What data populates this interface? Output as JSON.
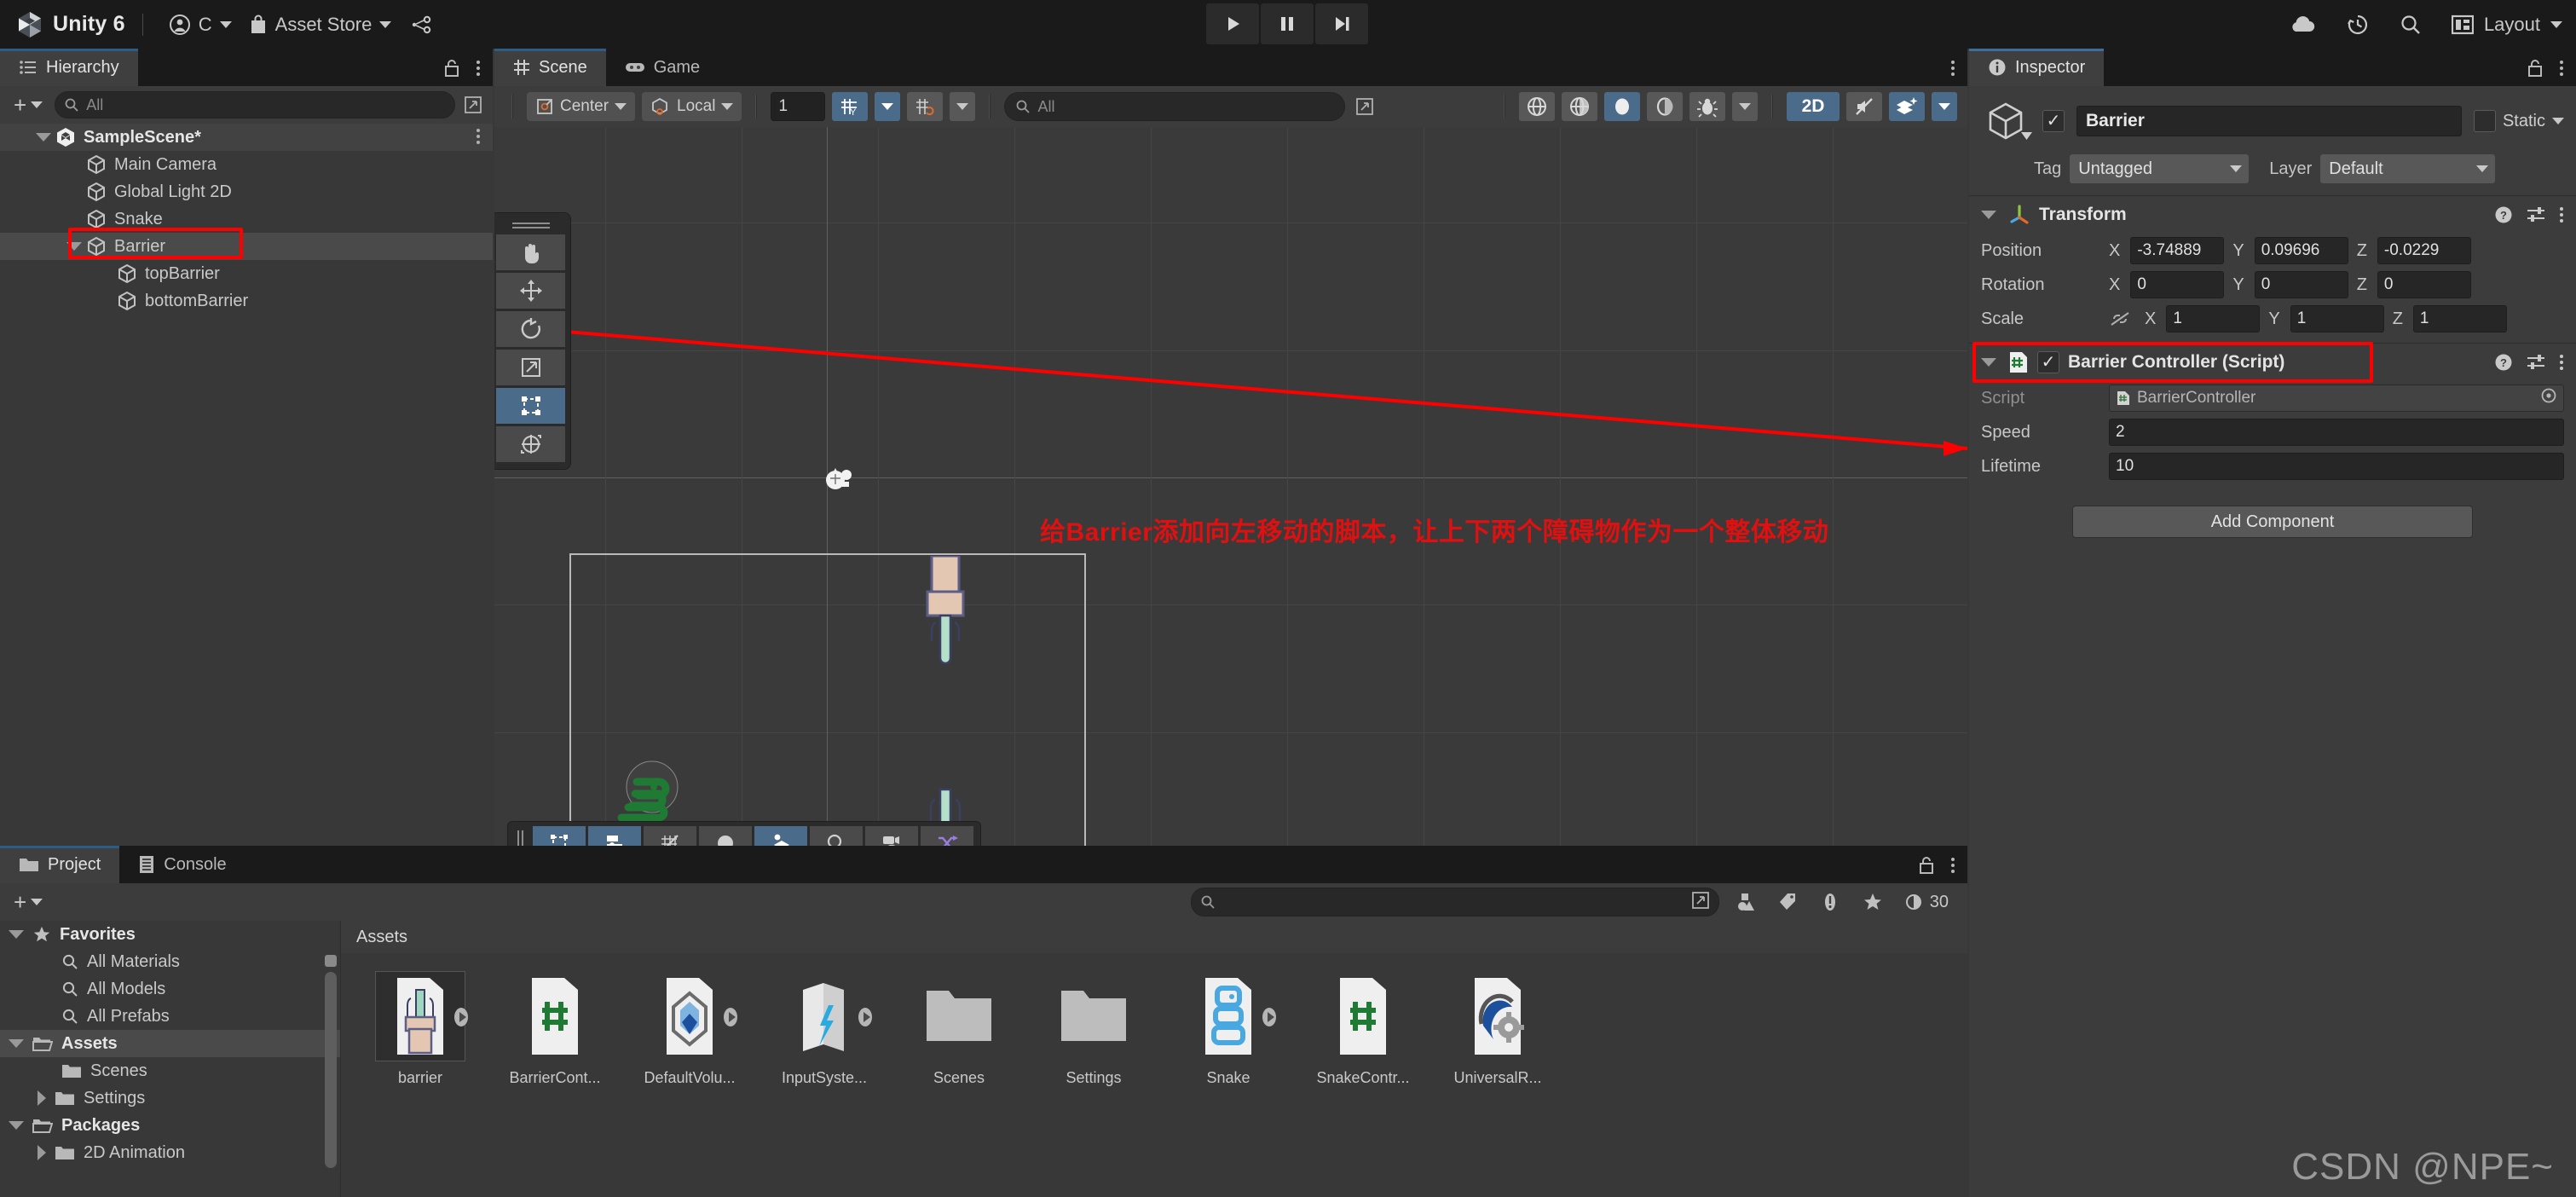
{
  "topbar": {
    "app_title": "Unity 6",
    "account_label": "C",
    "asset_store_label": "Asset Store",
    "icons": [
      "unity-logo-icon",
      "account-icon",
      "asset-store-bag-icon",
      "version-control-icon",
      "cloud-icon",
      "history-icon",
      "search-icon",
      "layout-icon"
    ],
    "layout_label": "Layout",
    "play_controls": [
      "play-button",
      "pause-button",
      "step-button"
    ]
  },
  "hierarchy": {
    "tab_label": "Hierarchy",
    "search_placeholder": "All",
    "items": [
      {
        "label": "SampleScene*",
        "depth": 0,
        "kind": "scene",
        "expanded": true,
        "selected": false
      },
      {
        "label": "Main Camera",
        "depth": 1,
        "kind": "gameobject",
        "expanded": false,
        "selected": false
      },
      {
        "label": "Global Light 2D",
        "depth": 1,
        "kind": "gameobject",
        "expanded": false,
        "selected": false
      },
      {
        "label": "Snake",
        "depth": 1,
        "kind": "gameobject",
        "expanded": false,
        "selected": false
      },
      {
        "label": "Barrier",
        "depth": 1,
        "kind": "gameobject",
        "expanded": true,
        "selected": true
      },
      {
        "label": "topBarrier",
        "depth": 2,
        "kind": "gameobject",
        "expanded": false,
        "selected": false
      },
      {
        "label": "bottomBarrier",
        "depth": 2,
        "kind": "gameobject",
        "expanded": false,
        "selected": false
      }
    ]
  },
  "scene": {
    "tabs": [
      {
        "label": "Scene",
        "icon": "grid-icon",
        "active": true
      },
      {
        "label": "Game",
        "icon": "gamepad-icon",
        "active": false
      }
    ],
    "toolbar": {
      "pivot_label": "Center",
      "handle_label": "Local",
      "grid_snap_value": "1",
      "search_placeholder": "All",
      "toggle_2d_label": "2D",
      "toggles": [
        "grid-snap-icon",
        "increment-snap-icon",
        "lighting-icon",
        "audio-icon",
        "fx-filled-icon",
        "fx-outline-icon",
        "debug-bug-icon",
        "2d-toggle",
        "audio-mute-icon",
        "effects-icon"
      ]
    },
    "tools_overlay": [
      "hand-tool",
      "move-tool",
      "rotate-tool",
      "scale-tool",
      "rect-tool",
      "transform-tool"
    ],
    "tools_active_index": 4,
    "bottom_overlay": [
      "rect-select-icon",
      "sliders-icon",
      "grid-visibility-icon",
      "sphere-icon",
      "layers-icon",
      "zoom-icon",
      "camera-preview-icon",
      "shuffle-icon"
    ],
    "annotation": "给Barrier添加向左移动的脚本，让上下两个障碍物作为一个整体移动"
  },
  "inspector": {
    "tab_label": "Inspector",
    "object_name": "Barrier",
    "object_enabled": true,
    "static_label": "Static",
    "static_checked": false,
    "tag_label": "Tag",
    "tag_value": "Untagged",
    "layer_label": "Layer",
    "layer_value": "Default",
    "transform": {
      "title": "Transform",
      "rows": [
        {
          "label": "Position",
          "x": "-3.74889",
          "y": "0.09696",
          "z": "-0.0229"
        },
        {
          "label": "Rotation",
          "x": "0",
          "y": "0",
          "z": "0"
        },
        {
          "label": "Scale",
          "x": "1",
          "y": "1",
          "z": "1"
        }
      ],
      "axis_labels": [
        "X",
        "Y",
        "Z"
      ]
    },
    "component": {
      "title": "Barrier Controller (Script)",
      "enabled": true,
      "script_label": "Script",
      "script_value": "BarrierController",
      "fields": [
        {
          "label": "Speed",
          "value": "2"
        },
        {
          "label": "Lifetime",
          "value": "10"
        }
      ]
    },
    "add_component_label": "Add Component"
  },
  "project": {
    "tabs": [
      {
        "label": "Project",
        "icon": "folder-icon",
        "active": true
      },
      {
        "label": "Console",
        "icon": "console-icon",
        "active": false
      }
    ],
    "search_placeholder": "",
    "visible_count": "30",
    "assets_breadcrumb": "Assets",
    "tree": [
      {
        "label": "Favorites",
        "depth": 0,
        "icon": "star-icon",
        "bold": true,
        "expanded": true,
        "selected": false
      },
      {
        "label": "All Materials",
        "depth": 1,
        "icon": "search-icon",
        "bold": false,
        "expanded": null,
        "selected": false
      },
      {
        "label": "All Models",
        "depth": 1,
        "icon": "search-icon",
        "bold": false,
        "expanded": null,
        "selected": false
      },
      {
        "label": "All Prefabs",
        "depth": 1,
        "icon": "search-icon",
        "bold": false,
        "expanded": null,
        "selected": false
      },
      {
        "label": "Assets",
        "depth": 0,
        "icon": "folder-open-icon",
        "bold": true,
        "expanded": true,
        "selected": true
      },
      {
        "label": "Scenes",
        "depth": 1,
        "icon": "folder-icon",
        "bold": false,
        "expanded": null,
        "selected": false
      },
      {
        "label": "Settings",
        "depth": 1,
        "icon": "folder-icon",
        "bold": false,
        "expanded": false,
        "selected": false
      },
      {
        "label": "Packages",
        "depth": 0,
        "icon": "folder-open-icon",
        "bold": true,
        "expanded": true,
        "selected": false
      },
      {
        "label": "2D Animation",
        "depth": 1,
        "icon": "folder-icon",
        "bold": false,
        "expanded": false,
        "selected": false
      }
    ],
    "assets": [
      {
        "label": "barrier",
        "type": "prefab",
        "selected": true
      },
      {
        "label": "BarrierCont...",
        "type": "script",
        "selected": false
      },
      {
        "label": "DefaultVolu...",
        "type": "volume-profile",
        "selected": false
      },
      {
        "label": "InputSyste...",
        "type": "input-actions",
        "selected": false
      },
      {
        "label": "Scenes",
        "type": "folder",
        "selected": false
      },
      {
        "label": "Settings",
        "type": "folder",
        "selected": false
      },
      {
        "label": "Snake",
        "type": "prefab-snake",
        "selected": false
      },
      {
        "label": "SnakeContr...",
        "type": "script",
        "selected": false
      },
      {
        "label": "UniversalR...",
        "type": "render-pipeline",
        "selected": false
      }
    ]
  },
  "watermark": "CSDN @NPE~",
  "colors": {
    "accent_blue": "#4b6b8a",
    "annotation_red": "#e01010",
    "panel_bg": "#383838",
    "toolbar_bg": "#3c3c3c",
    "topbar_bg": "#1a1a1a"
  }
}
